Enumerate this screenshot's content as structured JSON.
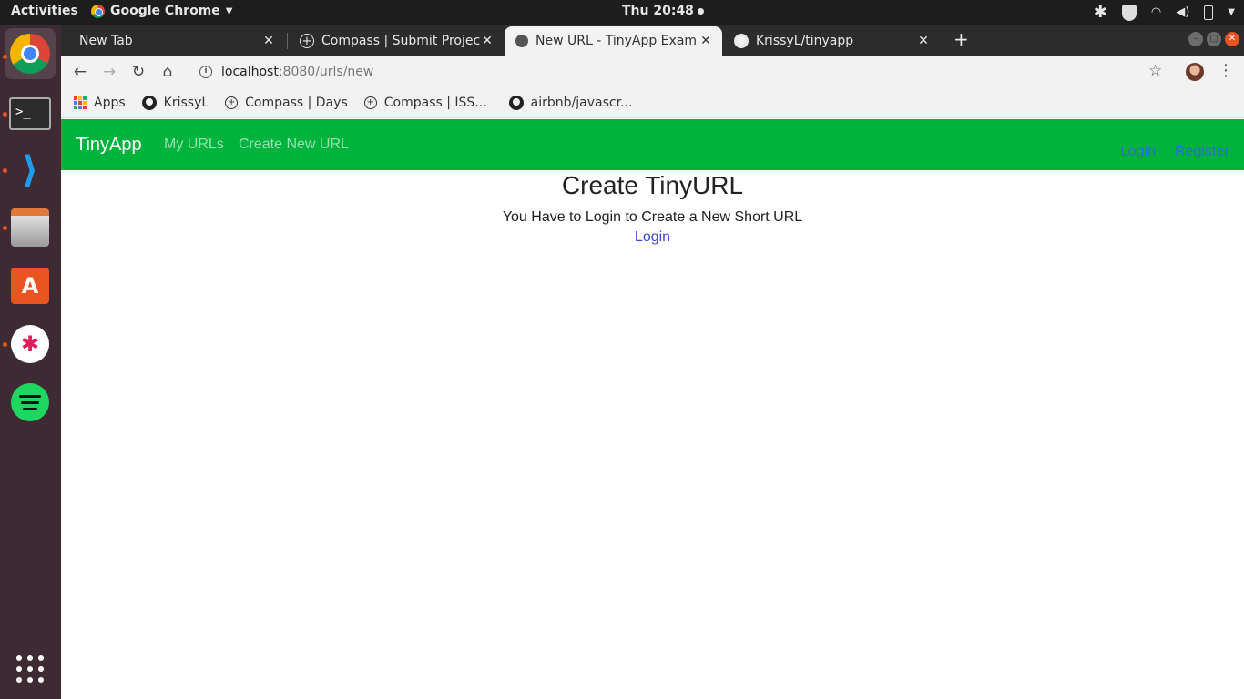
{
  "topbar": {
    "activities": "Activities",
    "app_name": "Google Chrome",
    "clock": "Thu 20:48"
  },
  "dock": {
    "items": [
      "Google Chrome",
      "Terminal",
      "Visual Studio Code",
      "Files",
      "Ubuntu Software",
      "Slack",
      "Spotify",
      "Show Applications"
    ]
  },
  "browser": {
    "tabs": [
      {
        "title": "New Tab"
      },
      {
        "title": "Compass | Submit Project"
      },
      {
        "title": "New URL - TinyApp Example"
      },
      {
        "title": "KrissyL/tinyapp"
      }
    ],
    "url_host": "localhost",
    "url_path": ":8080/urls/new",
    "bookmarks": [
      {
        "label": "Apps",
        "icon": "apps-grid-icon"
      },
      {
        "label": "KrissyL",
        "icon": "github-icon"
      },
      {
        "label": "Compass | Days",
        "icon": "compass-icon"
      },
      {
        "label": "Compass | ISS...",
        "icon": "compass-icon"
      },
      {
        "label": "airbnb/javascr...",
        "icon": "github-icon"
      }
    ]
  },
  "page": {
    "brand": "TinyApp",
    "nav": {
      "my_urls": "My URLs",
      "create_new": "Create New URL"
    },
    "auth": {
      "login": "Login",
      "register": "Register"
    },
    "heading": "Create TinyURL",
    "message": "You Have to Login to Create a New Short URL",
    "login_link": "Login",
    "colors": {
      "navbar": "#00b33c",
      "link": "#3b46d6"
    }
  }
}
